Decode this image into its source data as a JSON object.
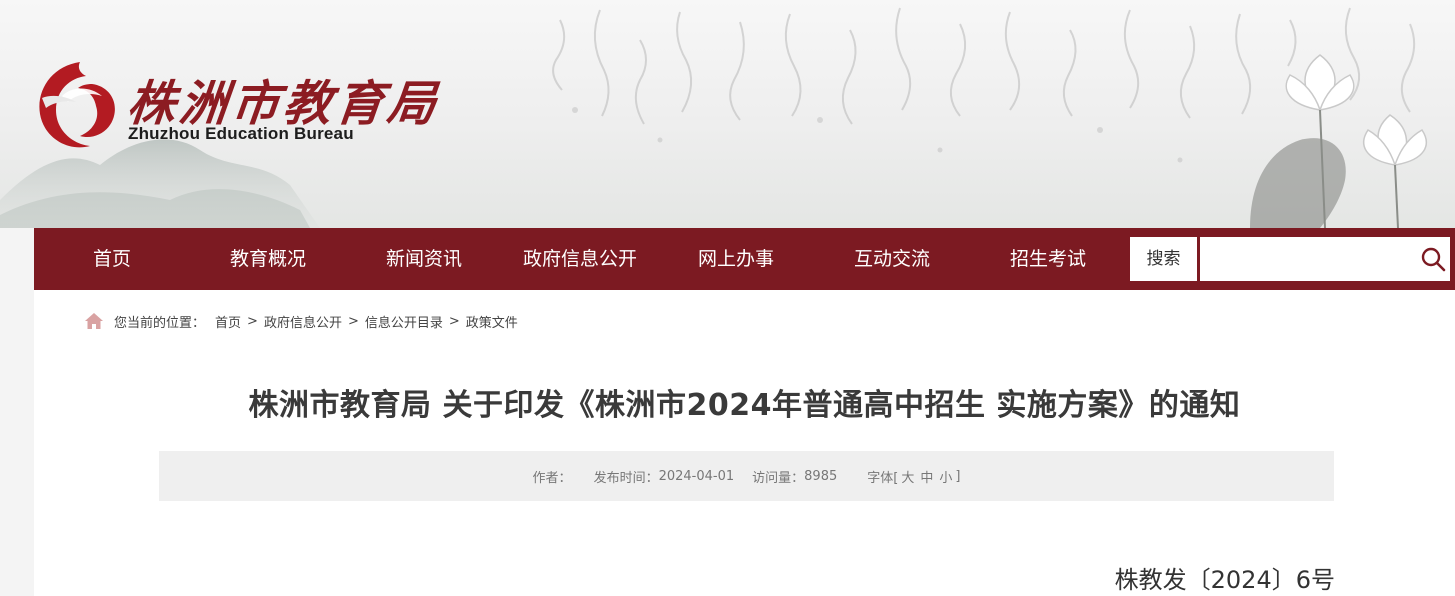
{
  "header": {
    "logo_cn": "株洲市教育局",
    "logo_en": "Zhuzhou Education Bureau"
  },
  "nav": {
    "items": [
      {
        "label": "首页"
      },
      {
        "label": "教育概况"
      },
      {
        "label": "新闻资讯"
      },
      {
        "label": "政府信息公开"
      },
      {
        "label": "网上办事"
      },
      {
        "label": "互动交流"
      },
      {
        "label": "招生考试"
      }
    ],
    "search_button": "搜索",
    "search_value": "",
    "search_icon": "search-icon"
  },
  "breadcrumb": {
    "label": "您当前的位置：",
    "icon": "home-icon",
    "items": [
      "首页",
      "政府信息公开",
      "信息公开目录",
      "政策文件"
    ],
    "separator": ">"
  },
  "article": {
    "title": "株洲市教育局 关于印发《株洲市2024年普通高中招生 实施方案》的通知",
    "meta": {
      "author_label": "作者：",
      "author": "",
      "date_label": "发布时间：",
      "date": "2024-04-01",
      "views_label": "访问量：",
      "views": "8985",
      "font_label": "字体[",
      "font_large": "大",
      "font_medium": "中",
      "font_small": "小",
      "font_end": "]"
    },
    "doc_number": "株教发〔2024〕6号"
  },
  "colors": {
    "nav_background": "#7c1a22",
    "logo_red": "#b31b22",
    "content_background": "#ffffff",
    "meta_background": "#efefef"
  }
}
